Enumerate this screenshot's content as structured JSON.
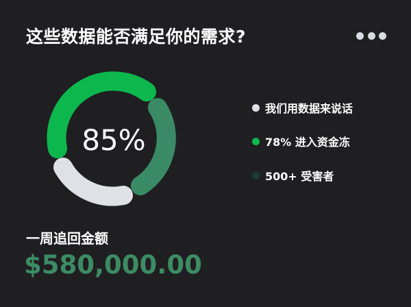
{
  "card": {
    "title": "这些数据能否满足你的需求?",
    "menu_icon": "more-horizontal-icon"
  },
  "chart_data": {
    "type": "pie",
    "center_label": "85%",
    "categories": [
      "我们用数据来说话",
      "78% 进入资金冻",
      "500+ 受害者"
    ],
    "colors": [
      "#dfe1e6",
      "#0cb84e",
      "#1e3a2e"
    ]
  },
  "legend": [
    {
      "label": "我们用数据来说话",
      "color": "#dfe1e6"
    },
    {
      "label": "78% 进入资金冻",
      "color": "#0cb84e"
    },
    {
      "label": "500+ 受害者",
      "color": "#1e3a2e"
    }
  ],
  "summary": {
    "label": "一周追回金额",
    "amount": "$580,000.00",
    "amount_color": "#3c8b64"
  }
}
